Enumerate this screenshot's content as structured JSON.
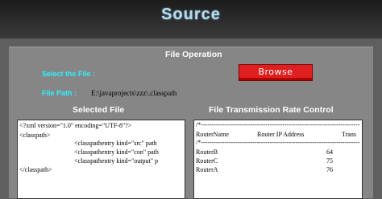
{
  "header": {
    "title": "Source"
  },
  "file_operation": {
    "title": "File Operation",
    "select_label": "Select the File :",
    "browse_label": "Browse",
    "path_label": "File Path  :",
    "path_value": "E:\\javaprojects\\zzz\\.classpath"
  },
  "selected_file": {
    "title": "Selected File",
    "lines": [
      "<?xml version=\"1.0\" encoding=\"UTF-8\"?>",
      "<classpath>",
      "<classpathentry kind=\"src\" path",
      "<classpathentry kind=\"con\" path",
      "<classpathentry kind=\"output\" p",
      "</classpath>"
    ]
  },
  "rate_control": {
    "title": "File Transmission Rate Control",
    "sep1": "/*--------------------------------------------------------------------------",
    "col_name": "RouterName",
    "col_ip": "Router IP Address",
    "col_trans": "Trans",
    "sep2": "/*--------------------------------------------------------------------------",
    "rows": [
      {
        "name": "RouterB",
        "value": "64"
      },
      {
        "name": "RouterC",
        "value": "75"
      },
      {
        "name": "RouterA",
        "value": "76"
      }
    ]
  }
}
